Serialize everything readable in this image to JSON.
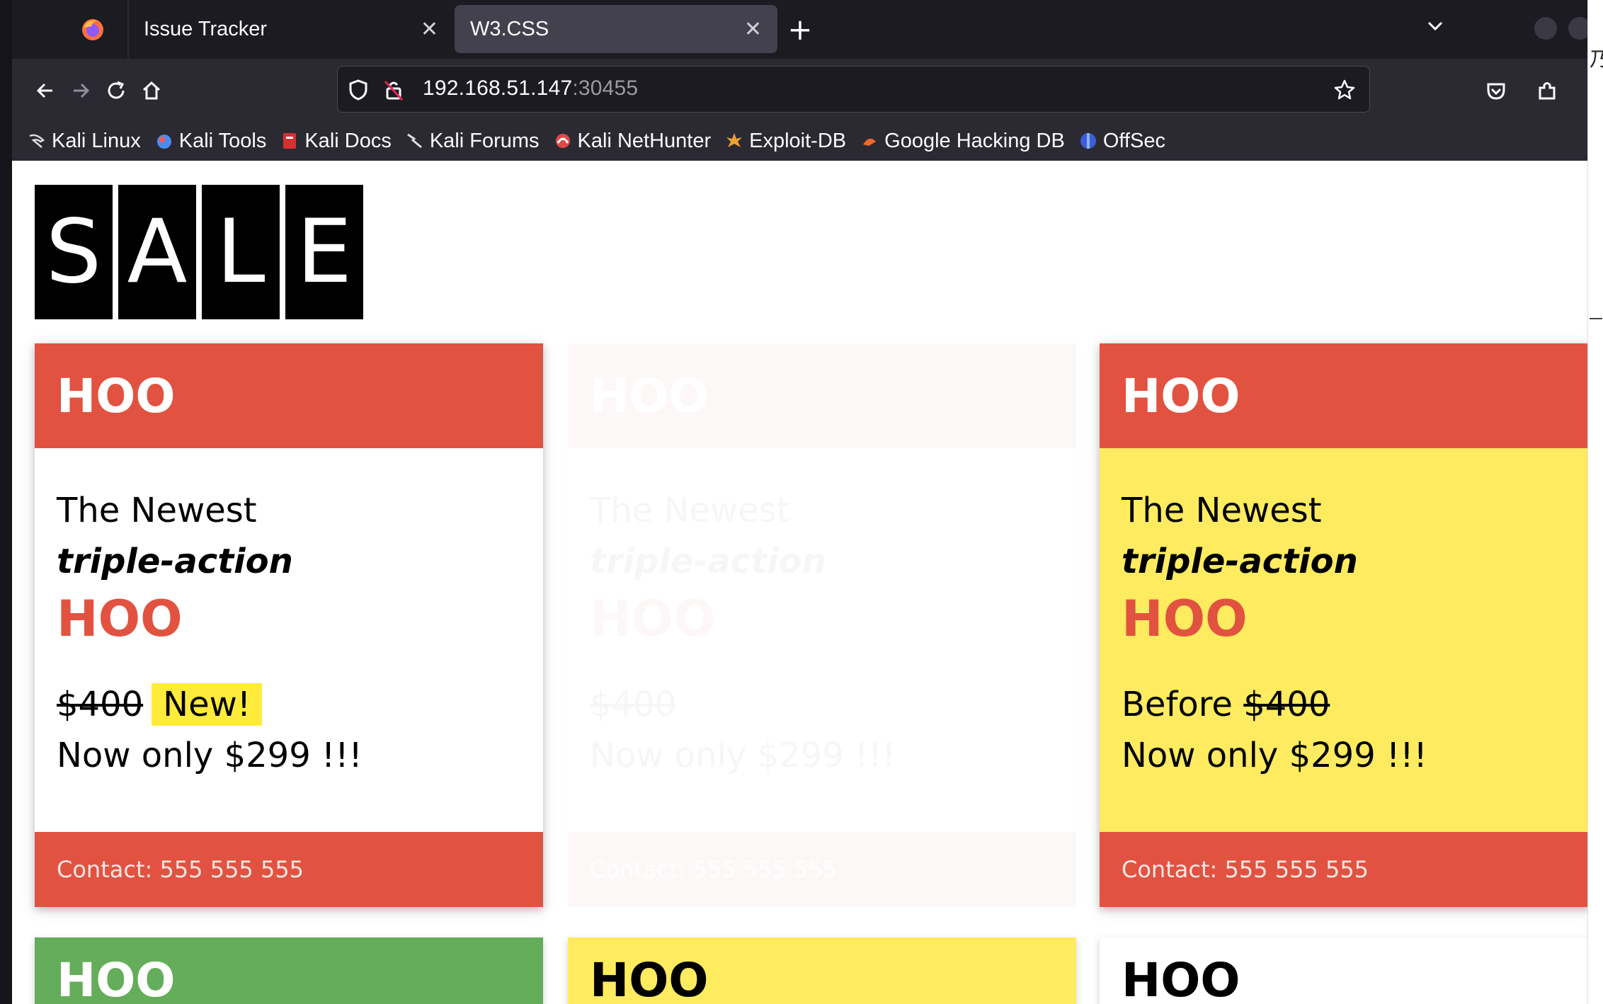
{
  "browser": {
    "tabs": [
      {
        "label": "Issue Tracker",
        "active": false
      },
      {
        "label": "W3.CSS",
        "active": true
      }
    ],
    "url_host": "192.168.51.147",
    "url_port": ":30455",
    "bookmarks": [
      {
        "label": "Kali Linux",
        "icon": "kali-dragon-icon"
      },
      {
        "label": "Kali Tools",
        "icon": "kali-tools-icon"
      },
      {
        "label": "Kali Docs",
        "icon": "kali-docs-icon"
      },
      {
        "label": "Kali Forums",
        "icon": "kali-forums-icon"
      },
      {
        "label": "Kali NetHunter",
        "icon": "nethunter-icon"
      },
      {
        "label": "Exploit-DB",
        "icon": "exploit-db-icon"
      },
      {
        "label": "Google Hacking DB",
        "icon": "ghdb-icon"
      },
      {
        "label": "OffSec",
        "icon": "offsec-icon"
      }
    ],
    "close_glyph": "✕",
    "new_tab_glyph": "+",
    "right_edge_text": "乃"
  },
  "page": {
    "sale_letters": [
      "S",
      "A",
      "L",
      "E"
    ],
    "cards": [
      {
        "header": "HOO",
        "line1": "The Newest",
        "line2": "triple-action",
        "product": "HOO",
        "old_price": "$400",
        "badge": "New!",
        "offer": "Now only $299 !!!",
        "contact": "Contact: 555 555 555"
      },
      {
        "header": "HOO",
        "line1": "The Newest",
        "line2": "triple-action",
        "product": "HOO",
        "old_price": "$400",
        "offer": "Now only $299 !!!",
        "contact": "Contact: 555 555 555"
      },
      {
        "header": "HOO",
        "line1": "The Newest",
        "line2": "triple-action",
        "product": "HOO",
        "before_label": "Before",
        "old_price": "$400",
        "offer": "Now only $299 !!!",
        "contact": "Contact: 555 555 555"
      }
    ],
    "row2_headers": [
      "HOO",
      "HOO",
      "HOO"
    ]
  },
  "colors": {
    "card_red": "#e25240",
    "card_yellow": "#ffeb5f",
    "card_green": "#64ad5a",
    "badge_yellow": "#ffeb3b"
  }
}
